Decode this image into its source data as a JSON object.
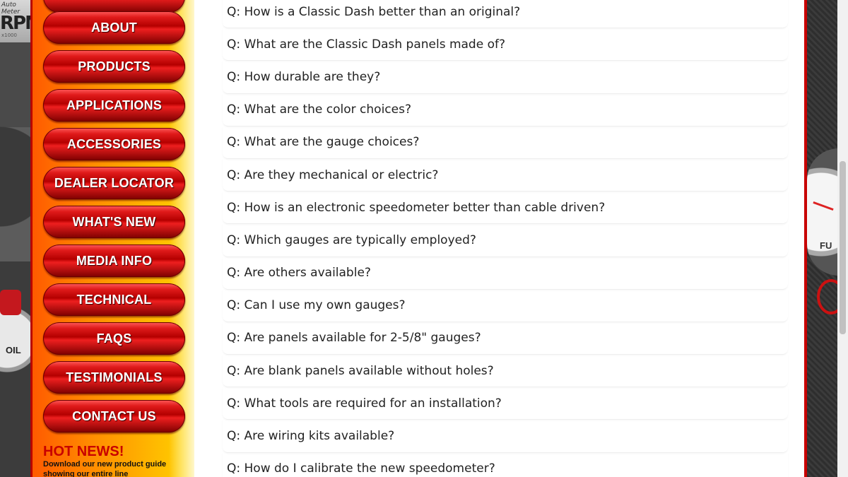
{
  "left_backdrop": {
    "logo_small": "Auto Meter",
    "logo_big": "RPM",
    "logo_sub": "x1000",
    "gauge_label": "OIL"
  },
  "sidebar": {
    "nav": [
      {
        "label": "ABOUT",
        "name": "nav-about"
      },
      {
        "label": "PRODUCTS",
        "name": "nav-products"
      },
      {
        "label": "APPLICATIONS",
        "name": "nav-applications"
      },
      {
        "label": "ACCESSORIES",
        "name": "nav-accessories"
      },
      {
        "label": "DEALER LOCATOR",
        "name": "nav-dealer-locator"
      },
      {
        "label": "WHAT'S NEW",
        "name": "nav-whats-new"
      },
      {
        "label": "MEDIA INFO",
        "name": "nav-media-info"
      },
      {
        "label": "TECHNICAL",
        "name": "nav-technical"
      },
      {
        "label": "FAQS",
        "name": "nav-faqs"
      },
      {
        "label": "TESTIMONIALS",
        "name": "nav-testimonials"
      },
      {
        "label": "CONTACT US",
        "name": "nav-contact-us"
      }
    ],
    "hot_news_title": "HOT NEWS!",
    "hot_news_text": "Download our new product guide showing our entire line"
  },
  "faqs": [
    "Q: How is a Classic Dash better than an original?",
    "Q: What are the Classic Dash panels made of?",
    "Q: How durable are they?",
    "Q: What are the color choices?",
    "Q: What are the gauge choices?",
    "Q: Are they mechanical or electric?",
    "Q: How is an electronic speedometer better than cable driven?",
    "Q: Which gauges are typically employed?",
    "Q: Are others available?",
    "Q: Can I use my own gauges?",
    "Q: Are panels available for 2-5/8\" gauges?",
    "Q: Are blank panels available without holes?",
    "Q: What tools are required for an installation?",
    "Q: Are wiring kits available?",
    "Q: How do I calibrate the new speedometer?"
  ],
  "right_backdrop": {
    "gauge_label": "FU"
  },
  "colors": {
    "sidebar_gradient_start": "#ff5a00",
    "sidebar_gradient_end": "#ffd500",
    "button_red": "#b40000",
    "border_red": "#c80000",
    "hot_news_red": "#c80000"
  }
}
